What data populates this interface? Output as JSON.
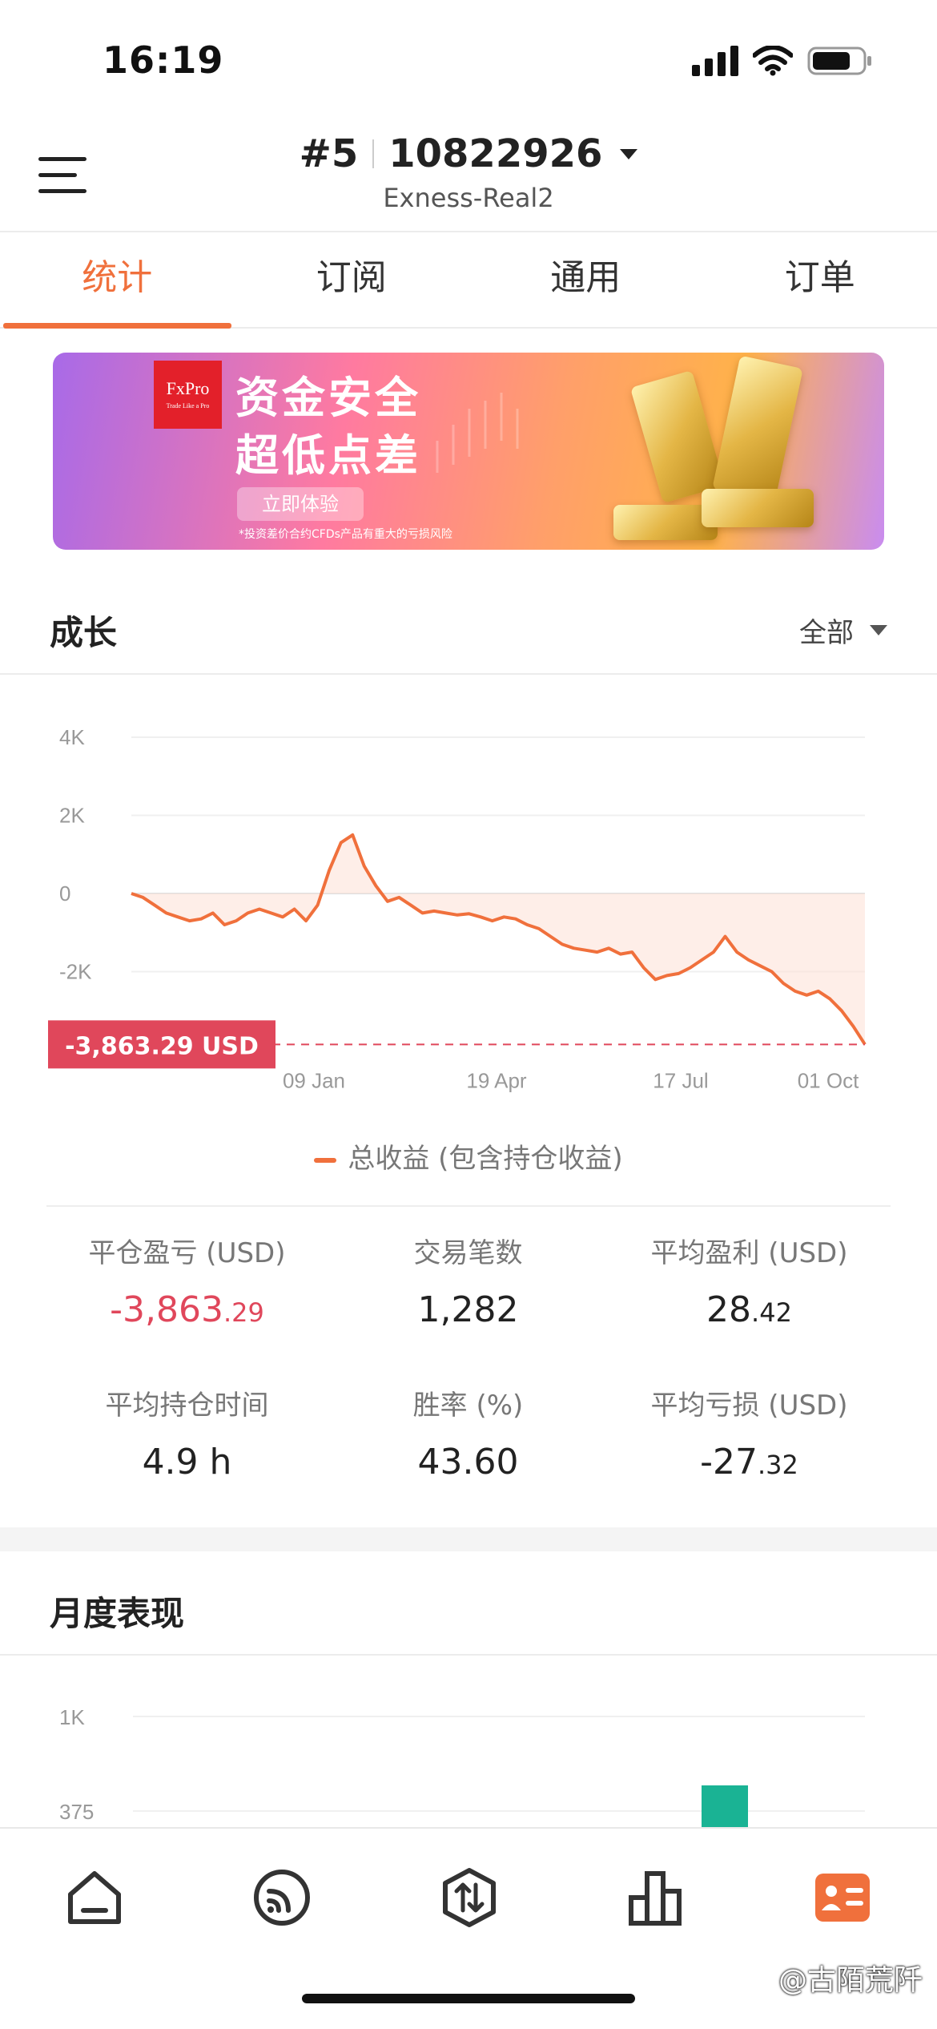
{
  "status_bar": {
    "time": "16:19"
  },
  "header": {
    "account_prefix": "#5",
    "account_number": "10822926",
    "server": "Exness-Real2"
  },
  "tabs": [
    {
      "label": "统计",
      "active": true
    },
    {
      "label": "订阅",
      "active": false
    },
    {
      "label": "通用",
      "active": false
    },
    {
      "label": "订单",
      "active": false
    }
  ],
  "banner": {
    "logo_text": "FxPro",
    "logo_tagline": "Trade Like a Pro",
    "line1": "资金安全",
    "line2": "超低点差",
    "button": "立即体验",
    "disclaimer": "*投资差价合约CFDs产品有重大的亏损风险"
  },
  "growth": {
    "title": "成长",
    "range": "全部",
    "legend": "总收益 (包含持仓收益)"
  },
  "chart_data": {
    "type": "area",
    "title": "",
    "ylabel": "",
    "xlabel": "",
    "ylim": [
      -4000,
      4000
    ],
    "y_ticks": [
      "4K",
      "2K",
      "0",
      "-2K"
    ],
    "x_ticks": [
      "09 Jan",
      "19 Apr",
      "17 Jul",
      "01 Oct"
    ],
    "current_value_label": "-3,863.29 USD",
    "current_value": -3863.29,
    "grid": true,
    "line_color": "#f0703c",
    "fill_color": "#fde3d8",
    "marker_color": "#e0475b",
    "series": [
      {
        "name": "总收益 (包含持仓收益)",
        "values": [
          0,
          -100,
          -300,
          -500,
          -600,
          -700,
          -650,
          -500,
          -800,
          -700,
          -500,
          -400,
          -500,
          -600,
          -400,
          -700,
          -300,
          600,
          1300,
          1500,
          700,
          200,
          -200,
          -100,
          -300,
          -500,
          -450,
          -500,
          -550,
          -520,
          -600,
          -700,
          -600,
          -650,
          -800,
          -900,
          -1100,
          -1300,
          -1400,
          -1450,
          -1500,
          -1400,
          -1550,
          -1500,
          -1900,
          -2200,
          -2100,
          -2050,
          -1900,
          -1700,
          -1500,
          -1100,
          -1500,
          -1700,
          -1850,
          -2000,
          -2300,
          -2500,
          -2600,
          -2500,
          -2700,
          -3000,
          -3400,
          -3863
        ]
      }
    ]
  },
  "stats": [
    {
      "label": "平仓盈亏 (USD)",
      "int": "-3,863",
      "dec": ".29",
      "negative": true
    },
    {
      "label": "交易笔数",
      "int": "1,282",
      "dec": "",
      "negative": false
    },
    {
      "label": "平均盈利 (USD)",
      "int": "28",
      "dec": ".42",
      "negative": false
    },
    {
      "label": "平均持仓时间",
      "int": "4.9 h",
      "dec": "",
      "negative": false
    },
    {
      "label": "胜率 (%)",
      "int": "43.60",
      "dec": "",
      "negative": false
    },
    {
      "label": "平均亏损 (USD)",
      "int": "-27",
      "dec": ".32",
      "negative": false
    }
  ],
  "monthly": {
    "title": "月度表现",
    "y_ticks": [
      "1K",
      "375"
    ],
    "bar_color": "#1ab394"
  },
  "nav": [
    "home",
    "signals",
    "trade",
    "analytics",
    "profile"
  ],
  "watermark": "@古陌荒阡"
}
